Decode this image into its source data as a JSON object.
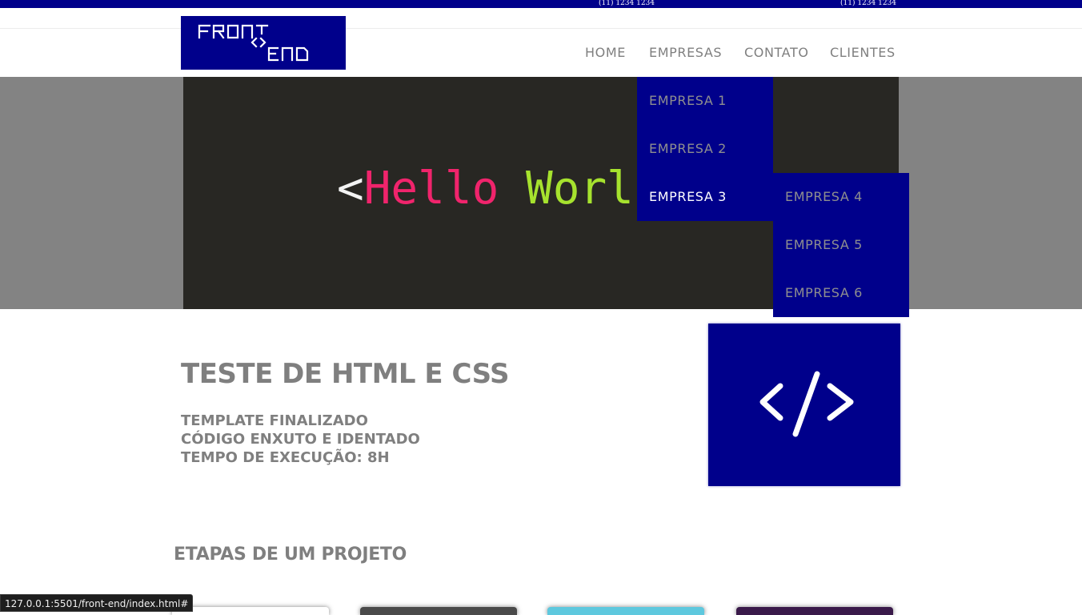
{
  "topbar": {
    "phone_1": "(11) 1234 1234",
    "phone_2": "(11) 1234 1234"
  },
  "logo": {
    "line1": "FRONT",
    "symbol": "<>",
    "line2": "END"
  },
  "nav": {
    "home": "HOME",
    "empresas": "EMPRESAS",
    "contato": "CONTATO",
    "clientes": "CLIENTES"
  },
  "dropdown": {
    "items": [
      "EMPRESA 1",
      "EMPRESA 2",
      "EMPRESA 3"
    ],
    "active": "EMPRESA 3"
  },
  "submenu": {
    "items": [
      "EMPRESA 4",
      "EMPRESA 5",
      "EMPRESA 6"
    ]
  },
  "hero": {
    "lt": "<",
    "hello": "Hello",
    "world": "Worl"
  },
  "intro": {
    "title": "TESTE DE HTML E CSS",
    "lines": [
      "TEMPLATE FINALIZADO",
      "CÓDIGO ENXUTO E IDENTADO",
      "TEMPO DE EXECUÇÃO: 8H"
    ]
  },
  "section": {
    "title": "ETAPAS DE UM PROJETO"
  },
  "status": {
    "url": "127.0.0.1:5501/front-end/index.html#"
  },
  "colors": {
    "brand": "#00008b",
    "text_gray": "#7f7f7f",
    "hero_bg": "#282723",
    "hello": "#f0246c",
    "world": "#a6e22e"
  },
  "icons": {
    "code": "code-brackets-icon"
  }
}
